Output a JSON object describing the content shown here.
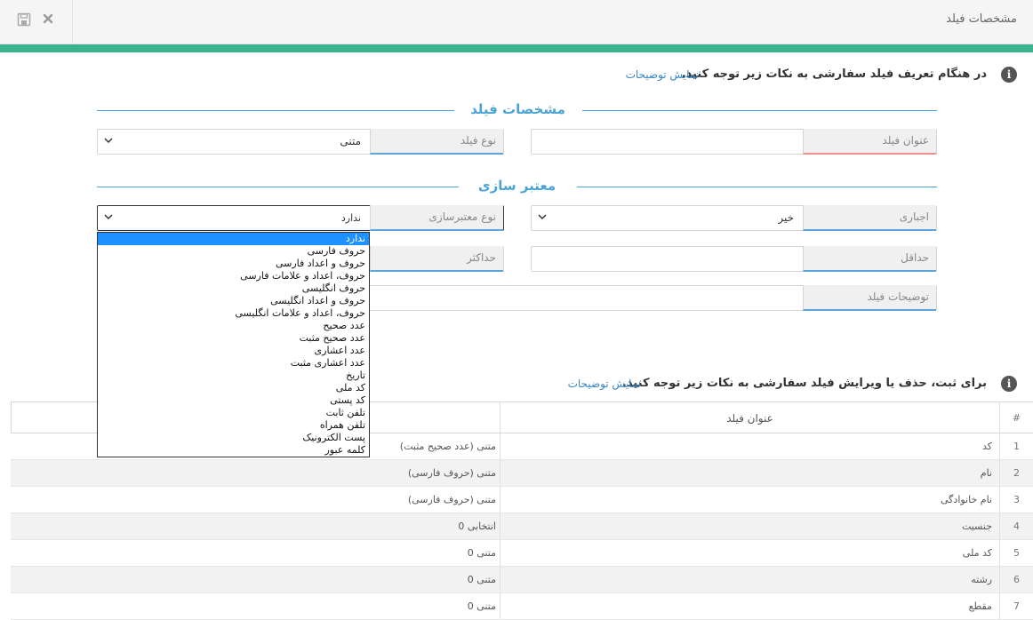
{
  "header": {
    "title": "مشخصات فیلد",
    "save_icon": "save-icon",
    "close_icon": "close-icon"
  },
  "info1": {
    "text": "در هنگام تعریف فیلد سفارشی به نکات زیر توجه کنید.",
    "link": "نمایش توضیحات"
  },
  "section_field": {
    "title": "مشخصات فیلد"
  },
  "field_title": {
    "label": "عنوان فیلد",
    "value": ""
  },
  "field_type": {
    "label": "نوع فیلد",
    "value": "متنی"
  },
  "section_validation": {
    "title": "معتبر سازی"
  },
  "required": {
    "label": "اجباری",
    "value": "خیر"
  },
  "validation_type": {
    "label": "نوع معتبرسازی",
    "value": "ندارد",
    "options": [
      "ندارد",
      "حروف فارسی",
      "حروف و اعداد فارسی",
      "حروف، اعداد و علامات فارسی",
      "حروف انگلیسی",
      "حروف و اعداد انگلیسی",
      "حروف، اعداد و علامات انگلیسی",
      "عدد صحیح",
      "عدد صحیح مثبت",
      "عدد اعشاری",
      "عدد اعشاری مثبت",
      "تاریخ",
      "کد ملی",
      "کد پستی",
      "تلفن ثابت",
      "تلفن همراه",
      "پست الکترونیک",
      "کلمه عبور"
    ]
  },
  "min": {
    "label": "حداقل",
    "value": ""
  },
  "max": {
    "label": "حداکثر",
    "value": ""
  },
  "description": {
    "label": "توضیحات فیلد",
    "value": ""
  },
  "info2": {
    "text": "برای ثبت، حذف یا ویرایش فیلد سفارشی به نکات زیر توجه کنید.",
    "link": "نمایش توضیحات"
  },
  "table": {
    "headers": {
      "num": "#",
      "title": "عنوان فیلد"
    },
    "rows": [
      {
        "num": "1",
        "title": "کد",
        "type": "متنی (عدد صحیح مثبت)"
      },
      {
        "num": "2",
        "title": "نام",
        "type": "متنی (حروف فارسی)"
      },
      {
        "num": "3",
        "title": "نام خانوادگی",
        "type": "متنی (حروف فارسی)"
      },
      {
        "num": "4",
        "title": "جنسیت",
        "type": "انتخابی 0"
      },
      {
        "num": "5",
        "title": "کد ملی",
        "type": "متنی 0"
      },
      {
        "num": "6",
        "title": "رشته",
        "type": "متنی 0"
      },
      {
        "num": "7",
        "title": "مقطع",
        "type": "متنی 0"
      }
    ]
  }
}
